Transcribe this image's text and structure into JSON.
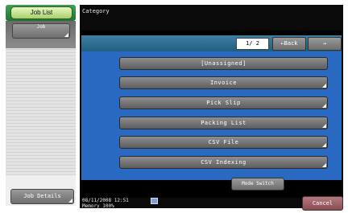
{
  "sidebar": {
    "tab_label": "Job List",
    "job_button_label": "Job",
    "job_details_label": "Job Details"
  },
  "header": {
    "title": "Category"
  },
  "toolbar": {
    "page_indicator": "1/ 2",
    "back_label": "←Back",
    "forward_label": "→"
  },
  "categories": [
    {
      "label": "[Unassigned]"
    },
    {
      "label": "Invoice"
    },
    {
      "label": "Pick Slip"
    },
    {
      "label": "Packing List"
    },
    {
      "label": "CSV File"
    },
    {
      "label": "CSV Indexing"
    }
  ],
  "mode_switch_label": "Mode Switch",
  "status": {
    "datetime": "08/11/2008  12:51",
    "memory": "Memory    100%"
  },
  "cancel_label": "Cancel",
  "colors": {
    "panel_bg": "#0a0a0a",
    "list_bg": "#2a69c2",
    "toolbar_bg": "#2f6e92",
    "tab_green": "#3fa055",
    "cancel_bg": "#8a4a52"
  },
  "icons": {
    "status_icon": "network-icon"
  }
}
